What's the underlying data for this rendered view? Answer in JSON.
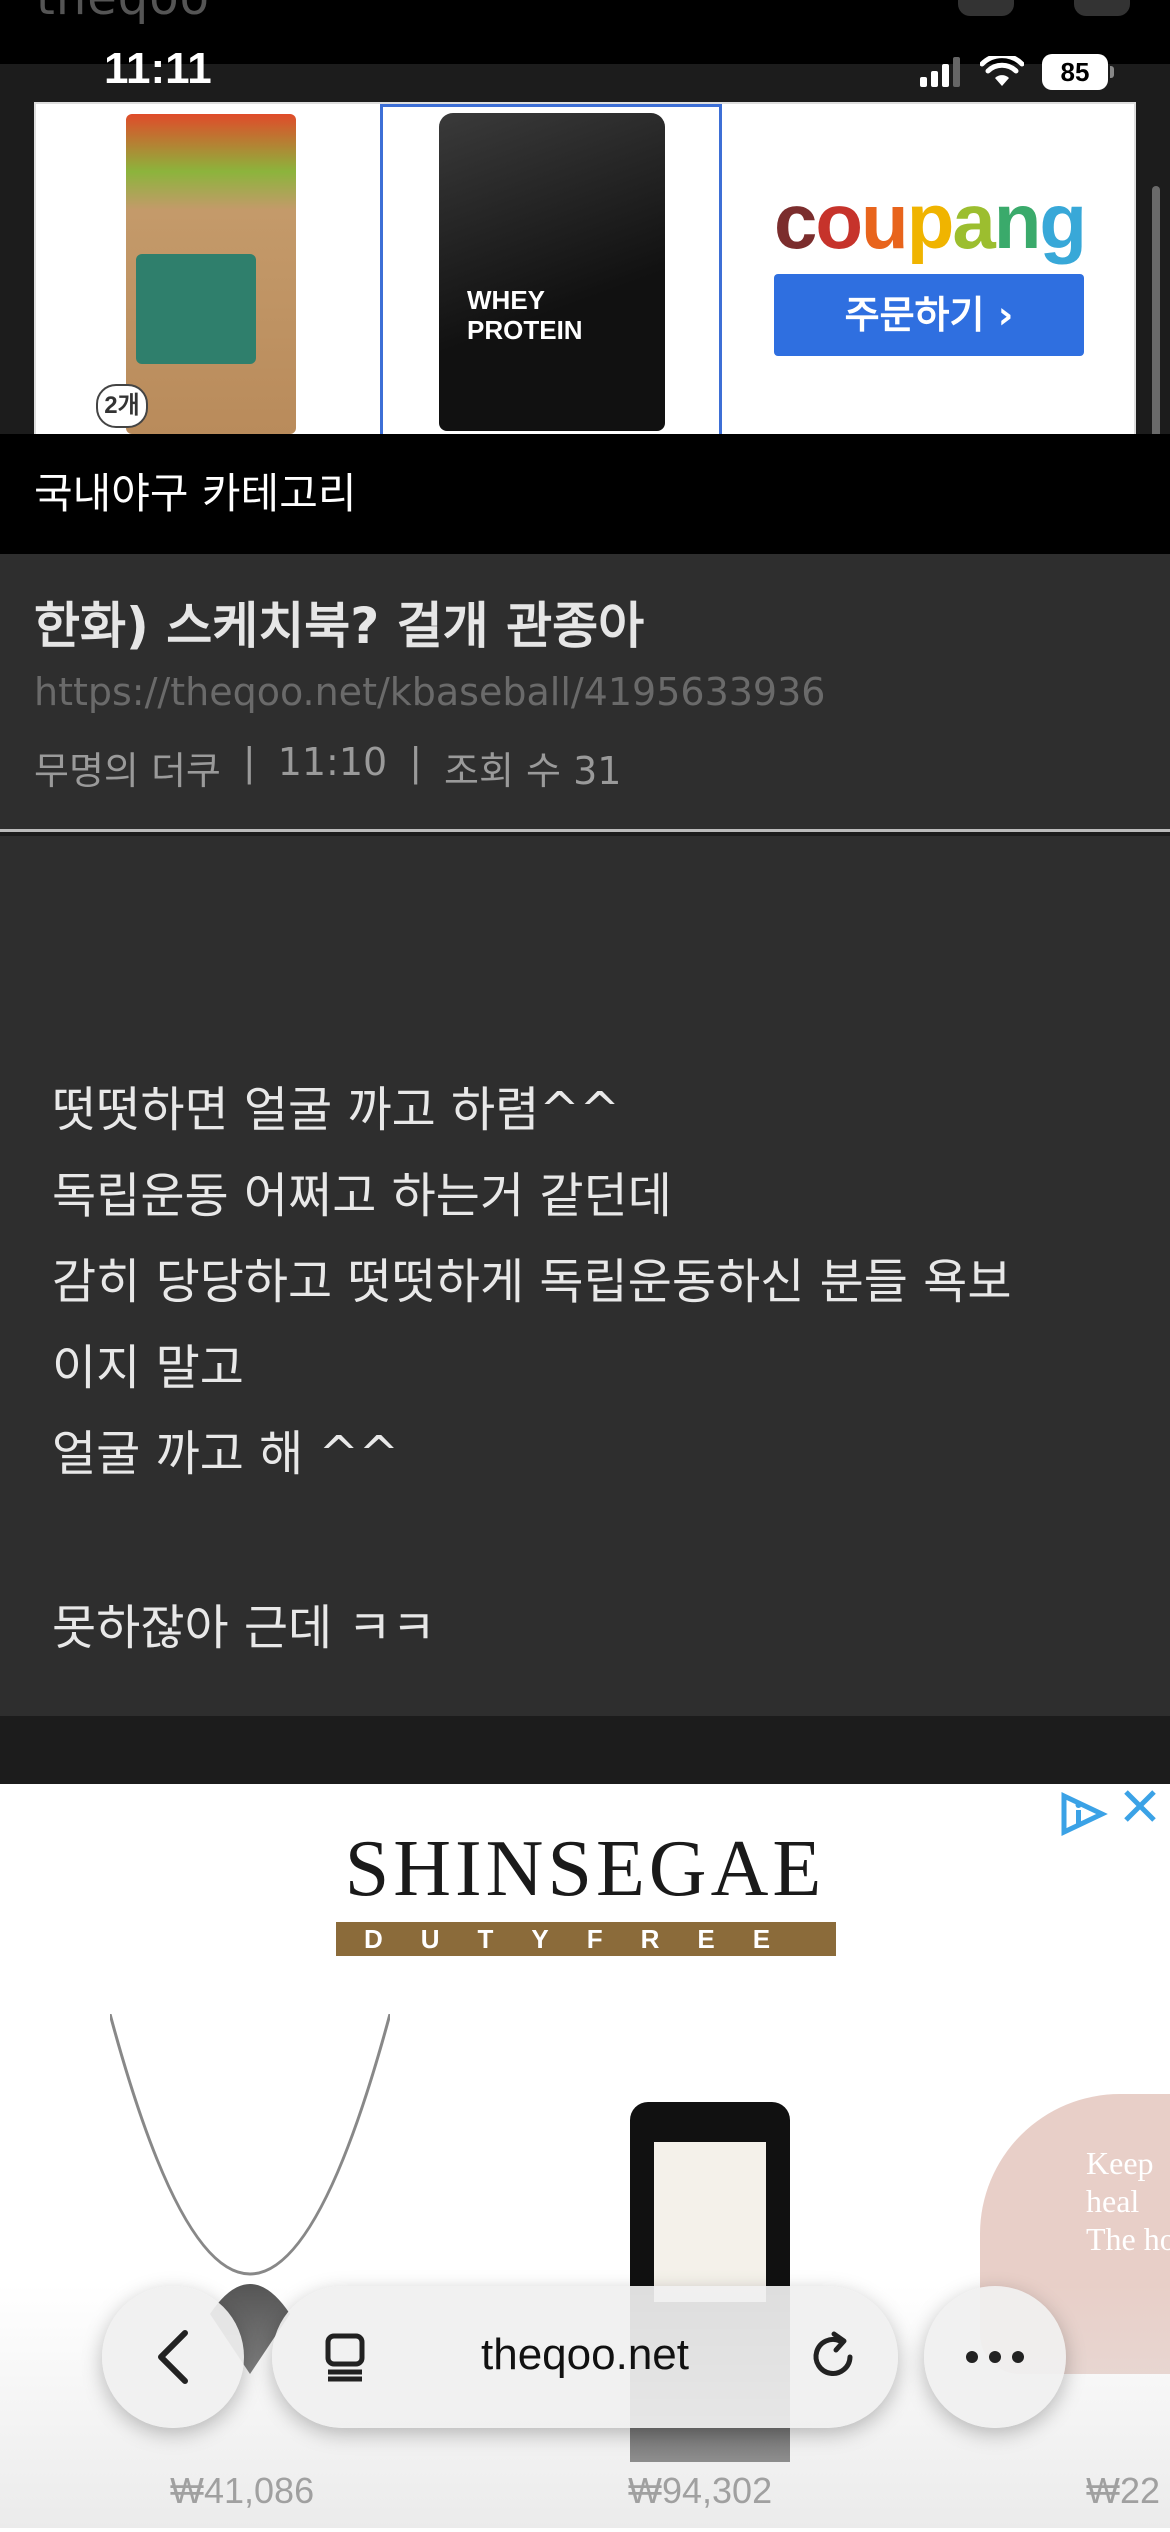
{
  "status_bar": {
    "ghost_site_name": "theqoo",
    "time": "11:11",
    "battery": "85"
  },
  "ads": {
    "coupang": {
      "logo_letters": [
        "c",
        "o",
        "u",
        "p",
        "a",
        "n",
        "g"
      ],
      "order_button": "주문하기 ›",
      "product1_qty": "2개",
      "product2_name": "WHEY PROTEIN"
    },
    "shinsegae": {
      "brand": "SHINSEGAE",
      "sub": "DUTYFREE",
      "prices": [
        "₩41,086",
        "₩94,302",
        "₩22"
      ],
      "cap_text": "Keep\nheal\nThe ho"
    }
  },
  "category": {
    "label": "국내야구 카테고리"
  },
  "post": {
    "title": "한화) 스케치북? 걸개 관종아",
    "url": "https://theqoo.net/kbaseball/4195633936",
    "author": "무명의 더쿠",
    "time": "11:10",
    "views": "조회 수 31",
    "sep": "|",
    "body_lines": [
      "떳떳하면 얼굴 까고 하렴^^",
      "독립운동 어쩌고 하는거 같던데",
      "감히 당당하고 떳떳하게 독립운동하신 분들 욕보",
      "이지 말고",
      "얼굴 까고 해 ^^",
      "",
      "못하잖아 근데 ㅋㅋ"
    ]
  },
  "browser": {
    "url": "theqoo.net"
  },
  "colors": {
    "background": "#1c1c1c",
    "post_bg": "#2e2e2e",
    "coupang_blue": "#2f6fe0",
    "shinsegae_gold": "#8b6b3a"
  }
}
